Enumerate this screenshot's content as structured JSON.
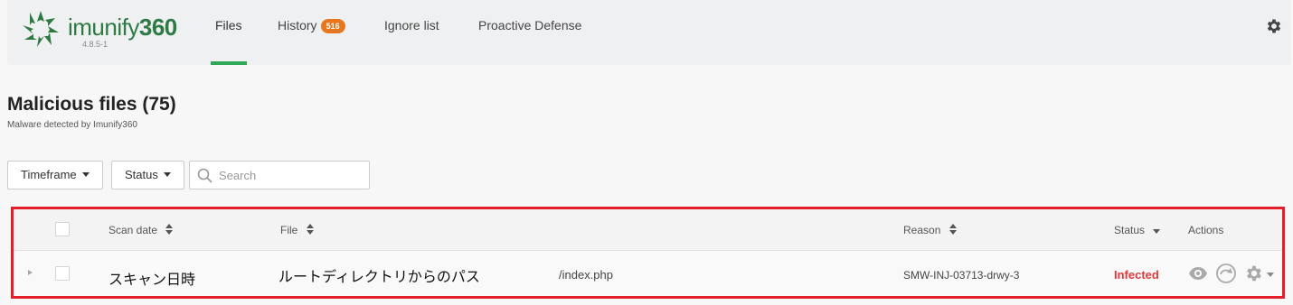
{
  "app": {
    "logo_text": "imunify",
    "logo_number": "360",
    "version": "4.8.5-1"
  },
  "nav": {
    "tabs": [
      {
        "label": "Files"
      },
      {
        "label": "History",
        "badge": "516"
      },
      {
        "label": "Ignore list"
      },
      {
        "label": "Proactive Defense"
      }
    ]
  },
  "page": {
    "title": "Malicious files (75)",
    "subtitle": "Malware detected by Imunify360"
  },
  "filters": {
    "timeframe_label": "Timeframe",
    "status_label": "Status",
    "search_placeholder": "Search"
  },
  "table": {
    "headers": {
      "scan_date": "Scan date",
      "file": "File",
      "reason": "Reason",
      "status": "Status",
      "actions": "Actions"
    },
    "rows": [
      {
        "scan_date": "スキャン日時",
        "file_root": "ルートディレクトリからのパス",
        "file_name": "/index.php",
        "reason": "SMW-INJ-03713-drwy-3",
        "status": "Infected"
      }
    ]
  },
  "colors": {
    "brand_green": "#2d7a43",
    "active_tab": "#2eaa57",
    "badge": "#e8761c",
    "infected": "#e0393e",
    "highlight_border": "#e41e2b"
  }
}
